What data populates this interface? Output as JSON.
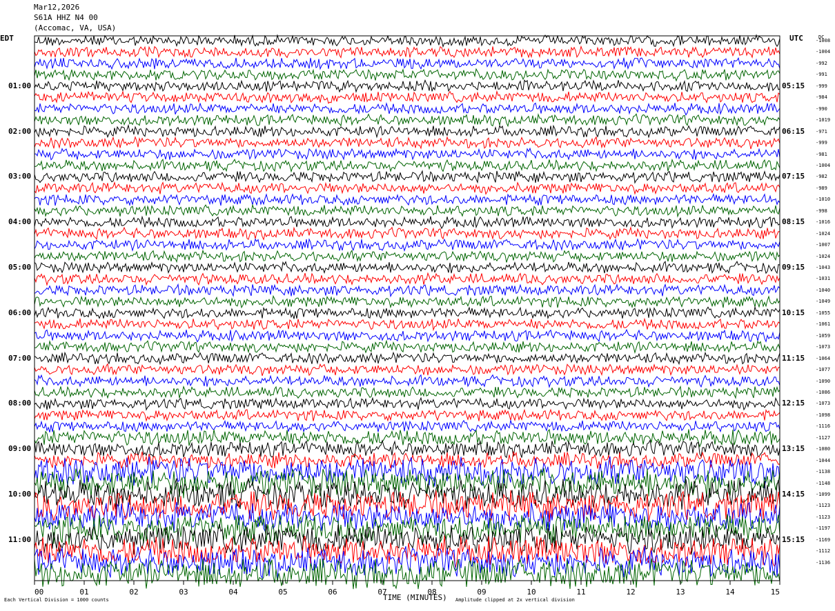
{
  "header": {
    "date": "Mar12,2026",
    "station": "S61A HHZ N4 00",
    "location": "(Accomac, VA, USA)"
  },
  "left_timezone": "EDT",
  "right_timezone": "UTC",
  "dc_label": "DC",
  "footer": {
    "left": "Each Vertical Division = 1000 counts",
    "center": "TIME (MINUTES)",
    "right": "Amplitude clipped at 2x vertical division"
  },
  "colors": {
    "trace_cycle": [
      "#000000",
      "#ff0000",
      "#0000ff",
      "#006400"
    ]
  },
  "chart_data": {
    "type": "line",
    "title": "S61A HHZ N4 00",
    "xlabel": "TIME (MINUTES)",
    "xlim": [
      0,
      15
    ],
    "x_ticks": [
      "00",
      "01",
      "02",
      "03",
      "04",
      "05",
      "06",
      "07",
      "08",
      "09",
      "10",
      "11",
      "12",
      "13",
      "14",
      "15"
    ],
    "rows_per_hour": 4,
    "row_count": 48,
    "left_hour_labels": [
      "01:00",
      "02:00",
      "03:00",
      "04:00",
      "05:00",
      "06:00",
      "07:00",
      "08:00",
      "09:00",
      "10:00",
      "11:00"
    ],
    "right_hour_labels": [
      "05:15",
      "06:15",
      "07:15",
      "08:15",
      "09:15",
      "10:15",
      "11:15",
      "12:15",
      "13:15",
      "14:15",
      "15:15"
    ],
    "dc_offsets": [
      -1008,
      -1004,
      -992,
      -991,
      -999,
      -984,
      -990,
      -1019,
      -971,
      -999,
      -981,
      -1004,
      -982,
      -989,
      -1010,
      -998,
      -1016,
      -1024,
      -1007,
      -1024,
      -1043,
      -1031,
      -1040,
      -1049,
      -1055,
      -1061,
      -1059,
      -1073,
      -1064,
      -1077,
      -1090,
      -1086,
      -1073,
      -1098,
      -1116,
      -1127,
      -1080,
      -1044,
      -1138,
      -1148,
      -1099,
      -1123,
      -1123,
      -1197,
      -1169,
      -1112,
      -1136
    ],
    "series": [
      {
        "name": "black",
        "color": "#000000"
      },
      {
        "name": "red",
        "color": "#ff0000"
      },
      {
        "name": "blue",
        "color": "#0000ff"
      },
      {
        "name": "green",
        "color": "#006400"
      }
    ]
  }
}
